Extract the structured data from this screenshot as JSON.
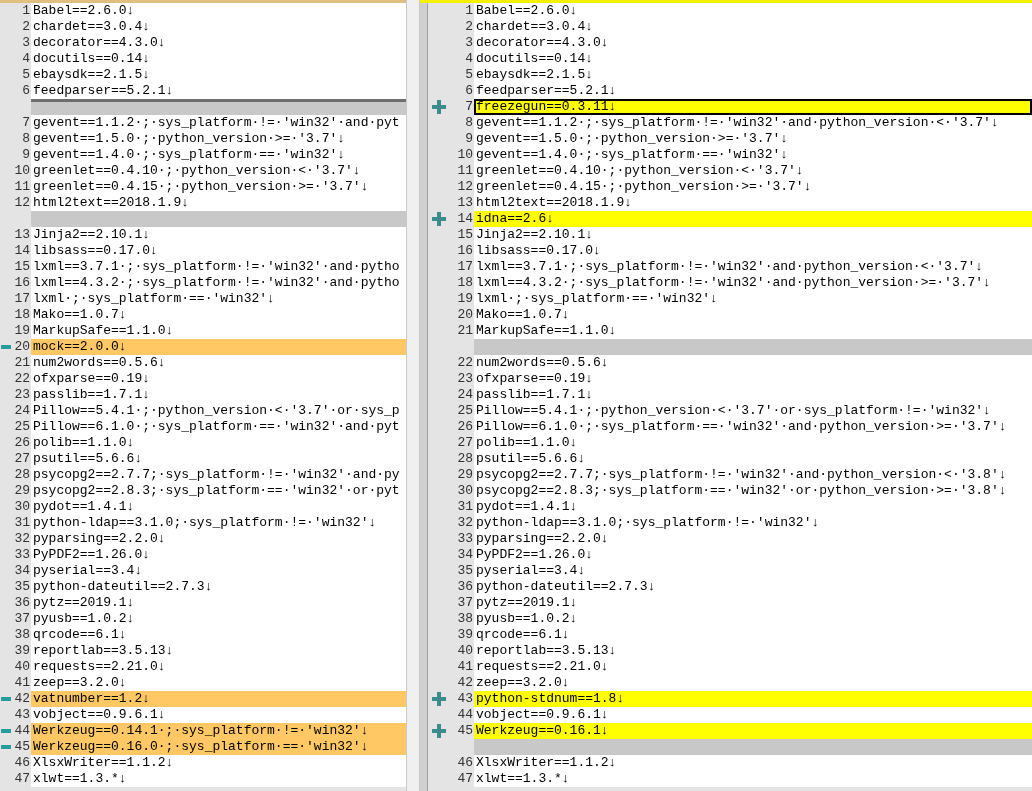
{
  "panes": [
    {
      "kind": "original",
      "lines": [
        {
          "kind": "line",
          "number": "1",
          "text": "Babel==2.6.0↓",
          "removed": false,
          "current": false
        },
        {
          "kind": "line",
          "number": "2",
          "text": "chardet==3.0.4↓",
          "removed": false,
          "current": false
        },
        {
          "kind": "line",
          "number": "3",
          "text": "decorator==4.3.0↓",
          "removed": false,
          "current": false
        },
        {
          "kind": "line",
          "number": "4",
          "text": "docutils==0.14↓",
          "removed": false,
          "current": false
        },
        {
          "kind": "line",
          "number": "5",
          "text": "ebaysdk==2.1.5↓",
          "removed": false,
          "current": false
        },
        {
          "kind": "line",
          "number": "6",
          "text": "feedparser==5.2.1↓",
          "removed": false,
          "current": false
        },
        {
          "kind": "gap",
          "current": true
        },
        {
          "kind": "line",
          "number": "7",
          "text": "gevent==1.1.2·;·sys_platform·!=·'win32'·and·pyt",
          "removed": false,
          "current": false
        },
        {
          "kind": "line",
          "number": "8",
          "text": "gevent==1.5.0·;·python_version·>=·'3.7'↓",
          "removed": false,
          "current": false
        },
        {
          "kind": "line",
          "number": "9",
          "text": "gevent==1.4.0·;·sys_platform·==·'win32'↓",
          "removed": false,
          "current": false
        },
        {
          "kind": "line",
          "number": "10",
          "text": "greenlet==0.4.10·;·python_version·<·'3.7'↓",
          "removed": false,
          "current": false
        },
        {
          "kind": "line",
          "number": "11",
          "text": "greenlet==0.4.15·;·python_version·>=·'3.7'↓",
          "removed": false,
          "current": false
        },
        {
          "kind": "line",
          "number": "12",
          "text": "html2text==2018.1.9↓",
          "removed": false,
          "current": false
        },
        {
          "kind": "gap",
          "current": false
        },
        {
          "kind": "line",
          "number": "13",
          "text": "Jinja2==2.10.1↓",
          "removed": false,
          "current": false
        },
        {
          "kind": "line",
          "number": "14",
          "text": "libsass==0.17.0↓",
          "removed": false,
          "current": false
        },
        {
          "kind": "line",
          "number": "15",
          "text": "lxml==3.7.1·;·sys_platform·!=·'win32'·and·pytho",
          "removed": false,
          "current": false
        },
        {
          "kind": "line",
          "number": "16",
          "text": "lxml==4.3.2·;·sys_platform·!=·'win32'·and·pytho",
          "removed": false,
          "current": false
        },
        {
          "kind": "line",
          "number": "17",
          "text": "lxml·;·sys_platform·==·'win32'↓",
          "removed": false,
          "current": false
        },
        {
          "kind": "line",
          "number": "18",
          "text": "Mako==1.0.7↓",
          "removed": false,
          "current": false
        },
        {
          "kind": "line",
          "number": "19",
          "text": "MarkupSafe==1.1.0↓",
          "removed": false,
          "current": false
        },
        {
          "kind": "line",
          "number": "20",
          "text": "mock==2.0.0↓",
          "removed": true,
          "current": false
        },
        {
          "kind": "line",
          "number": "21",
          "text": "num2words==0.5.6↓",
          "removed": false,
          "current": false
        },
        {
          "kind": "line",
          "number": "22",
          "text": "ofxparse==0.19↓",
          "removed": false,
          "current": false
        },
        {
          "kind": "line",
          "number": "23",
          "text": "passlib==1.7.1↓",
          "removed": false,
          "current": false
        },
        {
          "kind": "line",
          "number": "24",
          "text": "Pillow==5.4.1·;·python_version·<·'3.7'·or·sys_p",
          "removed": false,
          "current": false
        },
        {
          "kind": "line",
          "number": "25",
          "text": "Pillow==6.1.0·;·sys_platform·==·'win32'·and·pyt",
          "removed": false,
          "current": false
        },
        {
          "kind": "line",
          "number": "26",
          "text": "polib==1.1.0↓",
          "removed": false,
          "current": false
        },
        {
          "kind": "line",
          "number": "27",
          "text": "psutil==5.6.6↓",
          "removed": false,
          "current": false
        },
        {
          "kind": "line",
          "number": "28",
          "text": "psycopg2==2.7.7;·sys_platform·!=·'win32'·and·py",
          "removed": false,
          "current": false
        },
        {
          "kind": "line",
          "number": "29",
          "text": "psycopg2==2.8.3;·sys_platform·==·'win32'·or·pyt",
          "removed": false,
          "current": false
        },
        {
          "kind": "line",
          "number": "30",
          "text": "pydot==1.4.1↓",
          "removed": false,
          "current": false
        },
        {
          "kind": "line",
          "number": "31",
          "text": "python-ldap==3.1.0;·sys_platform·!=·'win32'↓",
          "removed": false,
          "current": false
        },
        {
          "kind": "line",
          "number": "32",
          "text": "pyparsing==2.2.0↓",
          "removed": false,
          "current": false
        },
        {
          "kind": "line",
          "number": "33",
          "text": "PyPDF2==1.26.0↓",
          "removed": false,
          "current": false
        },
        {
          "kind": "line",
          "number": "34",
          "text": "pyserial==3.4↓",
          "removed": false,
          "current": false
        },
        {
          "kind": "line",
          "number": "35",
          "text": "python-dateutil==2.7.3↓",
          "removed": false,
          "current": false
        },
        {
          "kind": "line",
          "number": "36",
          "text": "pytz==2019.1↓",
          "removed": false,
          "current": false
        },
        {
          "kind": "line",
          "number": "37",
          "text": "pyusb==1.0.2↓",
          "removed": false,
          "current": false
        },
        {
          "kind": "line",
          "number": "38",
          "text": "qrcode==6.1↓",
          "removed": false,
          "current": false
        },
        {
          "kind": "line",
          "number": "39",
          "text": "reportlab==3.5.13↓",
          "removed": false,
          "current": false
        },
        {
          "kind": "line",
          "number": "40",
          "text": "requests==2.21.0↓",
          "removed": false,
          "current": false
        },
        {
          "kind": "line",
          "number": "41",
          "text": "zeep==3.2.0↓",
          "removed": false,
          "current": false
        },
        {
          "kind": "line",
          "number": "42",
          "text": "vatnumber==1.2↓",
          "removed": true,
          "current": false
        },
        {
          "kind": "line",
          "number": "43",
          "text": "vobject==0.9.6.1↓",
          "removed": false,
          "current": false
        },
        {
          "kind": "line",
          "number": "44",
          "text": "Werkzeug==0.14.1·;·sys_platform·!=·'win32'↓",
          "removed": true,
          "current": false
        },
        {
          "kind": "line",
          "number": "45",
          "text": "Werkzeug==0.16.0·;·sys_platform·==·'win32'↓",
          "removed": true,
          "current": false
        },
        {
          "kind": "line",
          "number": "46",
          "text": "XlsxWriter==1.1.2↓",
          "removed": false,
          "current": false
        },
        {
          "kind": "line",
          "number": "47",
          "text": "xlwt==1.3.*↓",
          "removed": false,
          "current": false
        }
      ]
    },
    {
      "kind": "modified",
      "lines": [
        {
          "kind": "line",
          "number": "1",
          "text": "Babel==2.6.0↓",
          "added": false,
          "current": false
        },
        {
          "kind": "line",
          "number": "2",
          "text": "chardet==3.0.4↓",
          "added": false,
          "current": false
        },
        {
          "kind": "line",
          "number": "3",
          "text": "decorator==4.3.0↓",
          "added": false,
          "current": false
        },
        {
          "kind": "line",
          "number": "4",
          "text": "docutils==0.14↓",
          "added": false,
          "current": false
        },
        {
          "kind": "line",
          "number": "5",
          "text": "ebaysdk==2.1.5↓",
          "added": false,
          "current": false
        },
        {
          "kind": "line",
          "number": "6",
          "text": "feedparser==5.2.1↓",
          "added": false,
          "current": false
        },
        {
          "kind": "line",
          "number": "7",
          "text": "freezegun==0.3.11↓",
          "added": true,
          "current": true
        },
        {
          "kind": "line",
          "number": "8",
          "text": "gevent==1.1.2·;·sys_platform·!=·'win32'·and·python_version·<·'3.7'↓",
          "added": false,
          "current": false
        },
        {
          "kind": "line",
          "number": "9",
          "text": "gevent==1.5.0·;·python_version·>=·'3.7'↓",
          "added": false,
          "current": false
        },
        {
          "kind": "line",
          "number": "10",
          "text": "gevent==1.4.0·;·sys_platform·==·'win32'↓",
          "added": false,
          "current": false
        },
        {
          "kind": "line",
          "number": "11",
          "text": "greenlet==0.4.10·;·python_version·<·'3.7'↓",
          "added": false,
          "current": false
        },
        {
          "kind": "line",
          "number": "12",
          "text": "greenlet==0.4.15·;·python_version·>=·'3.7'↓",
          "added": false,
          "current": false
        },
        {
          "kind": "line",
          "number": "13",
          "text": "html2text==2018.1.9↓",
          "added": false,
          "current": false
        },
        {
          "kind": "line",
          "number": "14",
          "text": "idna==2.6↓",
          "added": true,
          "current": false
        },
        {
          "kind": "line",
          "number": "15",
          "text": "Jinja2==2.10.1↓",
          "added": false,
          "current": false
        },
        {
          "kind": "line",
          "number": "16",
          "text": "libsass==0.17.0↓",
          "added": false,
          "current": false
        },
        {
          "kind": "line",
          "number": "17",
          "text": "lxml==3.7.1·;·sys_platform·!=·'win32'·and·python_version·<·'3.7'↓",
          "added": false,
          "current": false
        },
        {
          "kind": "line",
          "number": "18",
          "text": "lxml==4.3.2·;·sys_platform·!=·'win32'·and·python_version·>=·'3.7'↓",
          "added": false,
          "current": false
        },
        {
          "kind": "line",
          "number": "19",
          "text": "lxml·;·sys_platform·==·'win32'↓",
          "added": false,
          "current": false
        },
        {
          "kind": "line",
          "number": "20",
          "text": "Mako==1.0.7↓",
          "added": false,
          "current": false
        },
        {
          "kind": "line",
          "number": "21",
          "text": "MarkupSafe==1.1.0↓",
          "added": false,
          "current": false
        },
        {
          "kind": "gap",
          "current": false
        },
        {
          "kind": "line",
          "number": "22",
          "text": "num2words==0.5.6↓",
          "added": false,
          "current": false
        },
        {
          "kind": "line",
          "number": "23",
          "text": "ofxparse==0.19↓",
          "added": false,
          "current": false
        },
        {
          "kind": "line",
          "number": "24",
          "text": "passlib==1.7.1↓",
          "added": false,
          "current": false
        },
        {
          "kind": "line",
          "number": "25",
          "text": "Pillow==5.4.1·;·python_version·<·'3.7'·or·sys_platform·!=·'win32'↓",
          "added": false,
          "current": false
        },
        {
          "kind": "line",
          "number": "26",
          "text": "Pillow==6.1.0·;·sys_platform·==·'win32'·and·python_version·>=·'3.7'↓",
          "added": false,
          "current": false
        },
        {
          "kind": "line",
          "number": "27",
          "text": "polib==1.1.0↓",
          "added": false,
          "current": false
        },
        {
          "kind": "line",
          "number": "28",
          "text": "psutil==5.6.6↓",
          "added": false,
          "current": false
        },
        {
          "kind": "line",
          "number": "29",
          "text": "psycopg2==2.7.7;·sys_platform·!=·'win32'·and·python_version·<·'3.8'↓",
          "added": false,
          "current": false
        },
        {
          "kind": "line",
          "number": "30",
          "text": "psycopg2==2.8.3;·sys_platform·==·'win32'·or·python_version·>=·'3.8'↓",
          "added": false,
          "current": false
        },
        {
          "kind": "line",
          "number": "31",
          "text": "pydot==1.4.1↓",
          "added": false,
          "current": false
        },
        {
          "kind": "line",
          "number": "32",
          "text": "python-ldap==3.1.0;·sys_platform·!=·'win32'↓",
          "added": false,
          "current": false
        },
        {
          "kind": "line",
          "number": "33",
          "text": "pyparsing==2.2.0↓",
          "added": false,
          "current": false
        },
        {
          "kind": "line",
          "number": "34",
          "text": "PyPDF2==1.26.0↓",
          "added": false,
          "current": false
        },
        {
          "kind": "line",
          "number": "35",
          "text": "pyserial==3.4↓",
          "added": false,
          "current": false
        },
        {
          "kind": "line",
          "number": "36",
          "text": "python-dateutil==2.7.3↓",
          "added": false,
          "current": false
        },
        {
          "kind": "line",
          "number": "37",
          "text": "pytz==2019.1↓",
          "added": false,
          "current": false
        },
        {
          "kind": "line",
          "number": "38",
          "text": "pyusb==1.0.2↓",
          "added": false,
          "current": false
        },
        {
          "kind": "line",
          "number": "39",
          "text": "qrcode==6.1↓",
          "added": false,
          "current": false
        },
        {
          "kind": "line",
          "number": "40",
          "text": "reportlab==3.5.13↓",
          "added": false,
          "current": false
        },
        {
          "kind": "line",
          "number": "41",
          "text": "requests==2.21.0↓",
          "added": false,
          "current": false
        },
        {
          "kind": "line",
          "number": "42",
          "text": "zeep==3.2.0↓",
          "added": false,
          "current": false
        },
        {
          "kind": "line",
          "number": "43",
          "text": "python-stdnum==1.8↓",
          "added": true,
          "current": false
        },
        {
          "kind": "line",
          "number": "44",
          "text": "vobject==0.9.6.1↓",
          "added": false,
          "current": false
        },
        {
          "kind": "line",
          "number": "45",
          "text": "Werkzeug==0.16.1↓",
          "added": true,
          "current": false
        },
        {
          "kind": "gap",
          "current": false
        },
        {
          "kind": "line",
          "number": "46",
          "text": "XlsxWriter==1.1.2↓",
          "added": false,
          "current": false
        },
        {
          "kind": "line",
          "number": "47",
          "text": "xlwt==1.3.*↓",
          "added": false,
          "current": false
        }
      ]
    }
  ]
}
